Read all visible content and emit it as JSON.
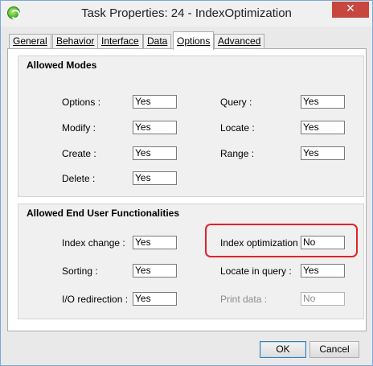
{
  "window": {
    "title": "Task Properties: 24 -    IndexOptimization",
    "close_glyph": "✕"
  },
  "tabs": [
    "General",
    "Behavior",
    "Interface",
    "Data",
    "Options",
    "Advanced"
  ],
  "active_tab": "Options",
  "allowed_modes": {
    "title": "Allowed Modes",
    "fields": {
      "options": {
        "label": "Options :",
        "value": "Yes"
      },
      "modify": {
        "label": "Modify :",
        "value": "Yes"
      },
      "create": {
        "label": "Create :",
        "value": "Yes"
      },
      "delete": {
        "label": "Delete :",
        "value": "Yes"
      },
      "query": {
        "label": "Query :",
        "value": "Yes"
      },
      "locate": {
        "label": "Locate :",
        "value": "Yes"
      },
      "range": {
        "label": "Range :",
        "value": "Yes"
      }
    }
  },
  "end_user": {
    "title": "Allowed End User Functionalities",
    "fields": {
      "index_change": {
        "label": "Index change :",
        "value": "Yes"
      },
      "sorting": {
        "label": "Sorting :",
        "value": "Yes"
      },
      "io_redirection": {
        "label": "I/O redirection :",
        "value": "Yes"
      },
      "index_optimization": {
        "label": "Index optimization :",
        "value": "No"
      },
      "locate_in_query": {
        "label": "Locate in query :",
        "value": "Yes"
      },
      "print_data": {
        "label": "Print data :",
        "value": "No"
      }
    }
  },
  "buttons": {
    "ok": "OK",
    "cancel": "Cancel"
  },
  "colors": {
    "highlight": "#e3222b",
    "close": "#c7463d"
  }
}
